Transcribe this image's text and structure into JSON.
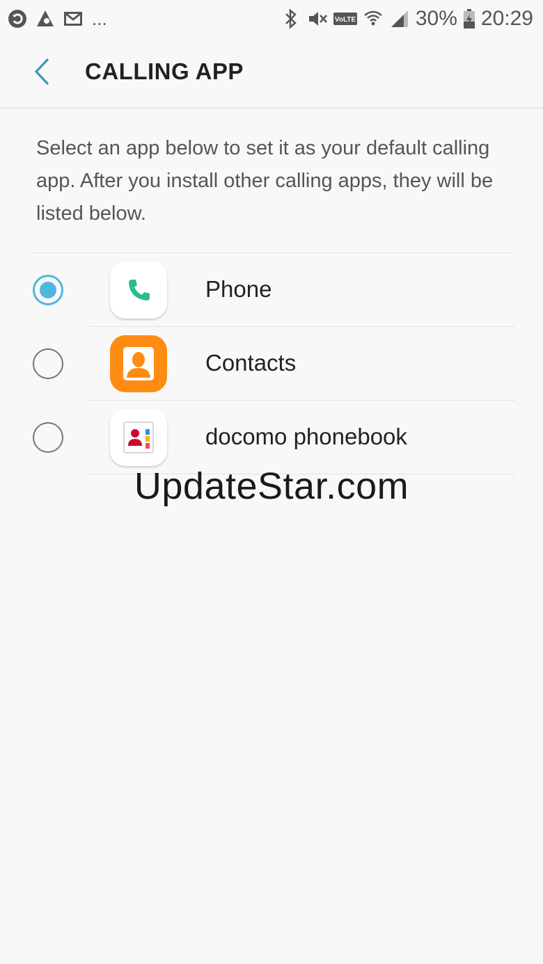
{
  "status_bar": {
    "left_icons": [
      "sync-icon",
      "a-app-icon",
      "gmail-icon"
    ],
    "more": "...",
    "right_icons": [
      "bluetooth-icon",
      "mute-icon",
      "volte-icon",
      "wifi-icon",
      "signal-icon"
    ],
    "volte_label": "VoLTE",
    "battery": "30%",
    "time": "20:29"
  },
  "header": {
    "back_icon": "chevron-left-icon",
    "title": "CALLING APP"
  },
  "description": "Select an app below to set it as your default calling app. After you install other calling apps, they will be listed below.",
  "apps": [
    {
      "label": "Phone",
      "icon": "phone-app-icon",
      "selected": true
    },
    {
      "label": "Contacts",
      "icon": "contacts-app-icon",
      "selected": false
    },
    {
      "label": "docomo phonebook",
      "icon": "docomo-phonebook-icon",
      "selected": false
    }
  ],
  "watermark": "UpdateStar.com",
  "colors": {
    "accent": "#4fb7dd",
    "phone_green": "#2bbd8a",
    "contacts_orange": "#ff8c12",
    "docomo_red": "#cc0a2c"
  }
}
